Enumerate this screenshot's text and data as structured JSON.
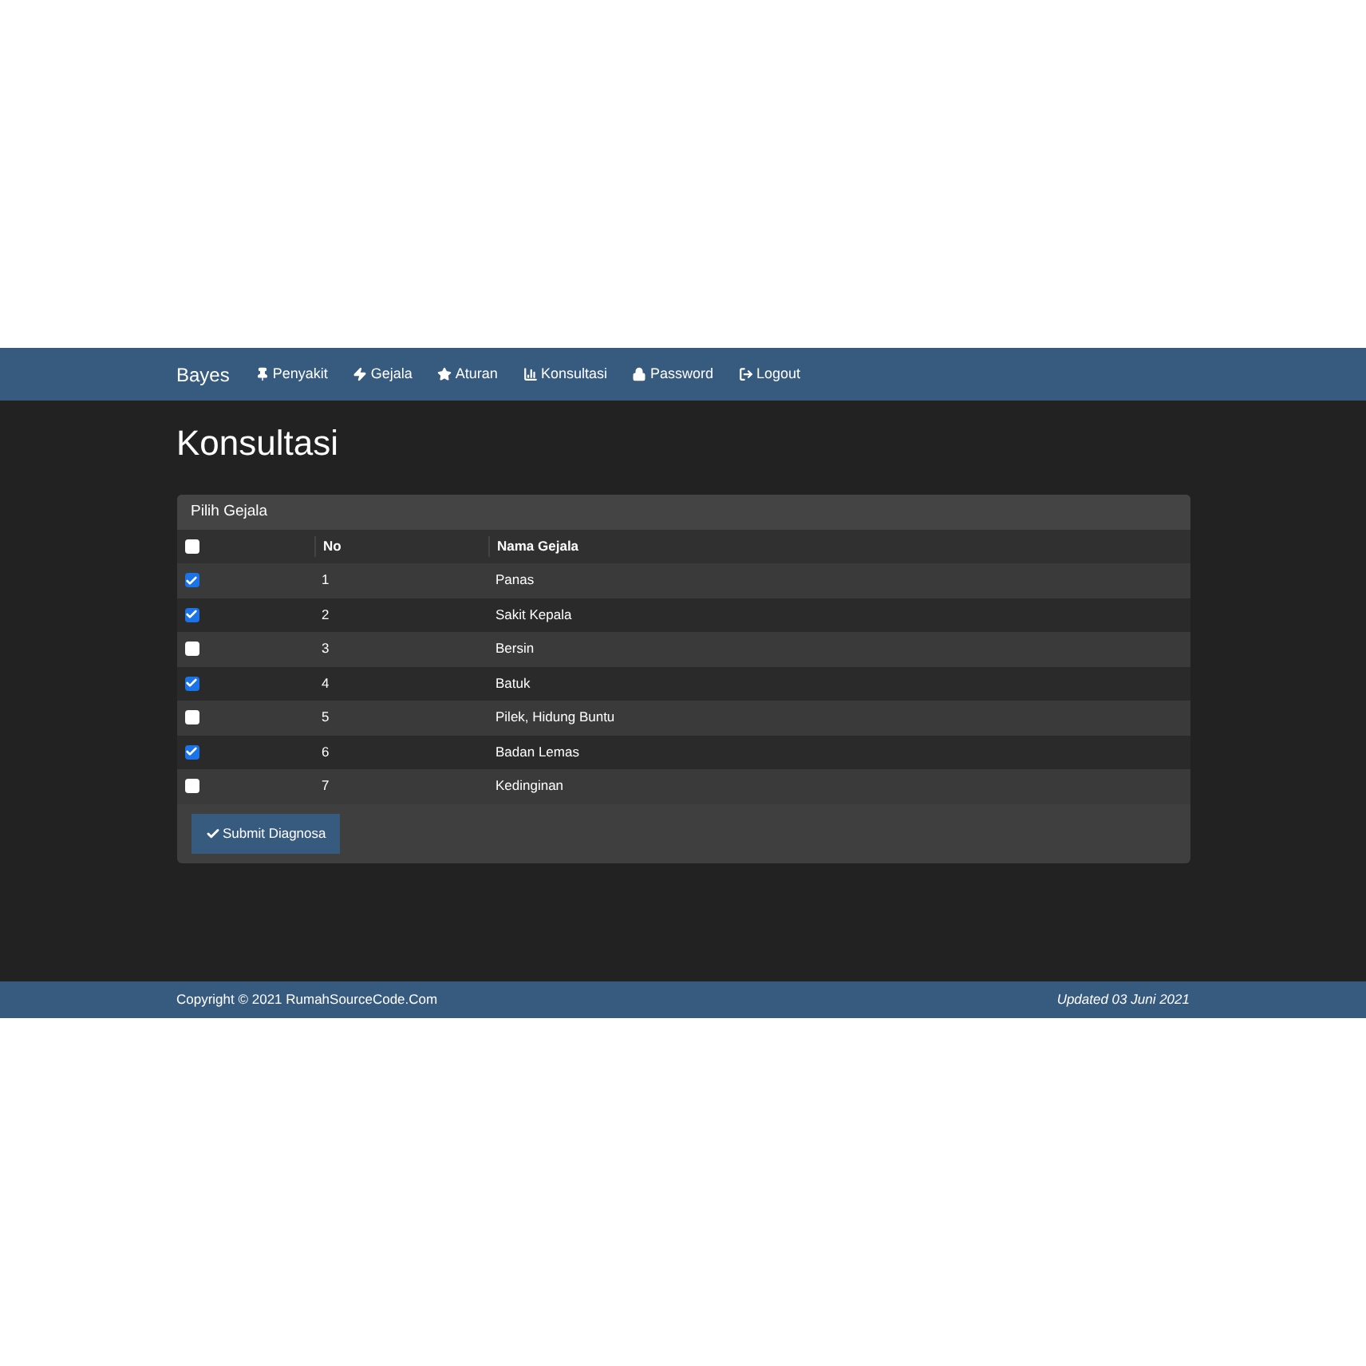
{
  "navbar": {
    "brand": "Bayes",
    "items": [
      {
        "label": "Penyakit"
      },
      {
        "label": "Gejala"
      },
      {
        "label": "Aturan"
      },
      {
        "label": "Konsultasi"
      },
      {
        "label": "Password"
      },
      {
        "label": "Logout"
      }
    ]
  },
  "page_title": "Konsultasi",
  "panel": {
    "title": "Pilih Gejala",
    "table": {
      "header_checked": false,
      "columns": [
        "No",
        "Nama Gejala"
      ],
      "rows": [
        {
          "checked": true,
          "no": "1",
          "name": "Panas"
        },
        {
          "checked": true,
          "no": "2",
          "name": "Sakit Kepala"
        },
        {
          "checked": false,
          "no": "3",
          "name": "Bersin"
        },
        {
          "checked": true,
          "no": "4",
          "name": "Batuk"
        },
        {
          "checked": false,
          "no": "5",
          "name": "Pilek, Hidung Buntu"
        },
        {
          "checked": true,
          "no": "6",
          "name": "Badan Lemas"
        },
        {
          "checked": false,
          "no": "7",
          "name": "Kedinginan"
        }
      ]
    },
    "submit_button": "Submit Diagnosa"
  },
  "footer": {
    "copyright": "Copyright © 2021 RumahSourceCode.Com",
    "updated": "Updated 03 Juni 2021"
  }
}
